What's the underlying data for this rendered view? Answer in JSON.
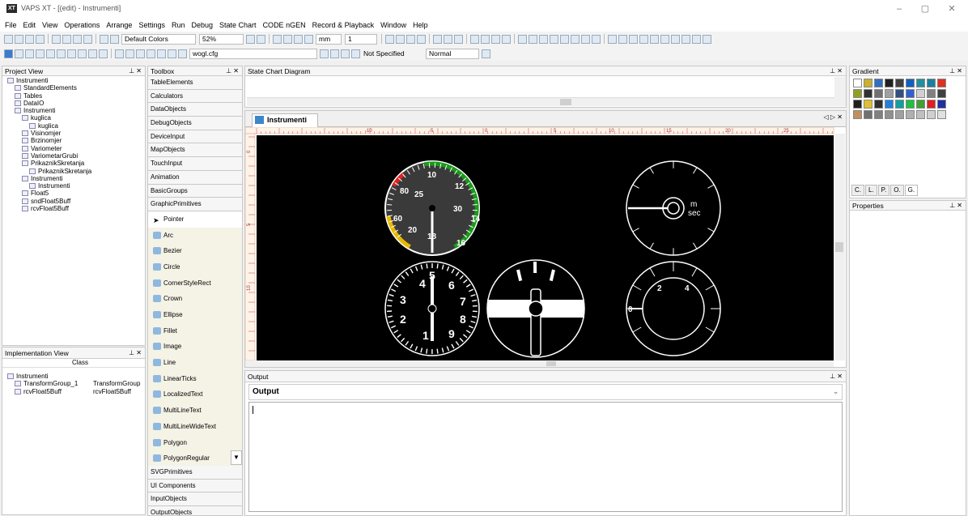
{
  "window": {
    "app_icon": "XT",
    "title": "VAPS XT - [(edit) - Instrumenti]",
    "minimize": "–",
    "maximize": "▢",
    "close": "✕"
  },
  "menu": [
    "File",
    "Edit",
    "View",
    "Operations",
    "Arrange",
    "Settings",
    "Run",
    "Debug",
    "State Chart",
    "CODE nGEN",
    "Record & Playback",
    "Window",
    "Help"
  ],
  "toolbar1": {
    "color_scheme": "Default Colors",
    "zoom": "52%",
    "units": "mm",
    "value": "1"
  },
  "toolbar2": {
    "config": "wogl.cfg",
    "spec": "Not Specified",
    "mode": "Normal"
  },
  "project_view": {
    "title": "Project View",
    "items": [
      {
        "label": "Instrumenti",
        "indent": 0
      },
      {
        "label": "StandardElements",
        "indent": 1
      },
      {
        "label": "Tables",
        "indent": 1
      },
      {
        "label": "DataIO",
        "indent": 1
      },
      {
        "label": "Instrumenti",
        "indent": 1
      },
      {
        "label": "kuglica",
        "indent": 2
      },
      {
        "label": "kuglica",
        "indent": 3
      },
      {
        "label": "Visinomjer",
        "indent": 2
      },
      {
        "label": "Brzinomjer",
        "indent": 2
      },
      {
        "label": "Variometer",
        "indent": 2
      },
      {
        "label": "VariometarGrubi",
        "indent": 2
      },
      {
        "label": "PrikaznikSkretanja",
        "indent": 2
      },
      {
        "label": "PrikaznikSkretanja",
        "indent": 3
      },
      {
        "label": "Instrumenti",
        "indent": 2
      },
      {
        "label": "Instrumenti",
        "indent": 3
      },
      {
        "label": "Float5",
        "indent": 2
      },
      {
        "label": "sndFloat5Buff",
        "indent": 2
      },
      {
        "label": "rcvFloat5Buff",
        "indent": 2
      }
    ]
  },
  "implementation_view": {
    "title": "Implementation View",
    "column": "Class",
    "rows": [
      {
        "name": "Instrumenti",
        "class": "",
        "indent": 0
      },
      {
        "name": "TransformGroup_1",
        "class": "TransformGroup",
        "indent": 1
      },
      {
        "name": "rcvFloat5Buff",
        "class": "rcvFloat5Buff",
        "indent": 1
      }
    ]
  },
  "toolbox": {
    "title": "Toolbox",
    "groups_top": [
      "TableElements",
      "Calculators",
      "DataObjects",
      "DebugObjects",
      "DeviceInput",
      "MapObjects",
      "TouchInput",
      "Animation",
      "BasicGroups",
      "GraphicPrimitives"
    ],
    "tools": [
      "Pointer",
      "Arc",
      "Bezier",
      "Circle",
      "CornerStyleRect",
      "Crown",
      "Ellipse",
      "Fillet",
      "Image",
      "Line",
      "LinearTicks",
      "LocalizedText",
      "MultiLineText",
      "MultiLineWideText",
      "Polygon",
      "PolygonRegular"
    ],
    "groups_bottom": [
      "SVGPrimitives",
      "UI Components",
      "InputObjects",
      "OutputObjects"
    ]
  },
  "state_chart": {
    "title": "State Chart Diagram"
  },
  "editor": {
    "tab": "Instrumenti",
    "ruler": [
      "0",
      "5",
      "10",
      "15",
      "20",
      "25"
    ],
    "ruler_neg": [
      "-10",
      "-5"
    ],
    "vruler": [
      "0",
      "5",
      "10"
    ],
    "airspeed": {
      "labels": [
        "10",
        "12",
        "14",
        "16",
        "18",
        "20",
        "25",
        "30",
        "60",
        "80"
      ],
      "needle_value": 18
    },
    "variometer": {
      "unit_top": "m",
      "unit_bottom": "sec"
    },
    "altimeter": {
      "labels": [
        "4",
        "5",
        "6",
        "7",
        "8",
        "9",
        "1",
        "2",
        "3"
      ]
    },
    "vario_coarse": {
      "labels": [
        "2",
        "4",
        "0"
      ]
    }
  },
  "output": {
    "title": "Output",
    "label": "Output"
  },
  "gradient": {
    "title": "Gradient",
    "colors": [
      "#ffffff",
      "#c8b030",
      "#3070c0",
      "#202020",
      "#404040",
      "#1060c0",
      "#2090a0",
      "#1a80a0",
      "#e03020",
      "#90a020",
      "#303030",
      "#707070",
      "#a0a0a0",
      "#305080",
      "#3060d0",
      "#d0d0d0",
      "#808080",
      "#404040",
      "#202020",
      "#e0c030",
      "#303030",
      "#2080e0",
      "#10a0a0",
      "#20c040",
      "#40a030",
      "#e02020",
      "#2030a0",
      "#c09060",
      "#707070",
      "#808080",
      "#909090",
      "#a0a0a0",
      "#b0b0b0",
      "#c0c0c0",
      "#d0d0d0",
      "#e0e0e0"
    ],
    "tabs": [
      "C.",
      "L.",
      "P.",
      "O.",
      "G."
    ]
  },
  "properties": {
    "title": "Properties"
  }
}
